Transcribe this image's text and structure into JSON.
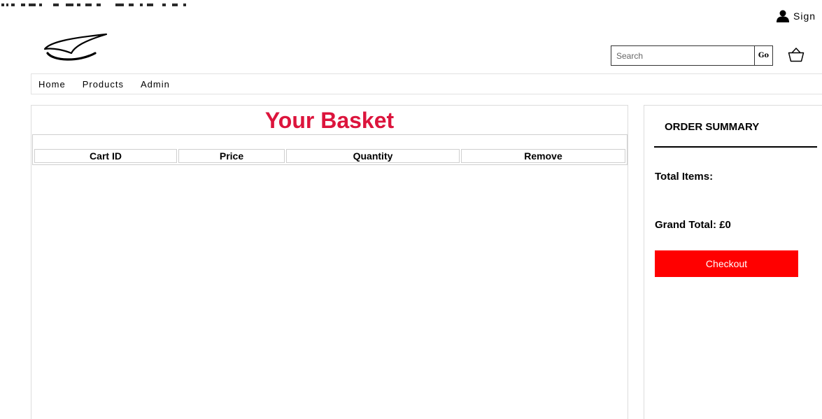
{
  "header": {
    "sign_in_label": "Sign",
    "search_placeholder": "Search",
    "search_value": "",
    "go_label": "Go",
    "user_icon": "user-icon",
    "basket_icon": "basket-icon",
    "logo_icon": "swoosh-logo"
  },
  "nav": {
    "items": [
      {
        "label": "Home"
      },
      {
        "label": "Products"
      },
      {
        "label": "Admin"
      }
    ]
  },
  "basket": {
    "title": "Your Basket",
    "columns": [
      "Cart ID",
      "Price",
      "Quantity",
      "Remove"
    ],
    "rows": []
  },
  "summary": {
    "title": "ORDER SUMMARY",
    "total_items_label": "Total Items:",
    "grand_total_label": "Grand Total: £0",
    "checkout_label": "Checkout"
  },
  "colors": {
    "title_accent": "#dc143c",
    "checkout_bg": "#ff0000"
  }
}
